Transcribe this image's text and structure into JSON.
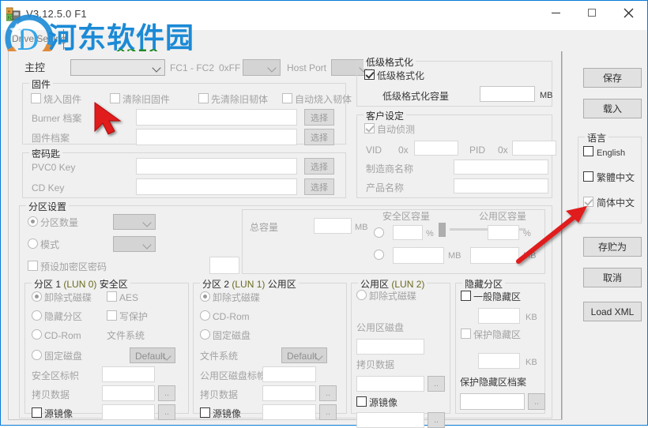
{
  "window": {
    "title": "V3.12.5.0 F1",
    "minimize_label": "minimize",
    "maximize_label": "maximize",
    "close_label": "close",
    "tab_label": "Drive Setting"
  },
  "watermark": {
    "text": "河东软件园",
    "url": "www.pc0359.cn"
  },
  "top_row": {
    "controller_label": "主控",
    "controller_value": "",
    "fc_label": "FC1 - FC2",
    "hex_label": "0xFF -",
    "hex_value": "",
    "host_port_label": "Host Port",
    "host_port_value": ""
  },
  "firmware": {
    "title": "固件",
    "burn_fw": "烧入固件",
    "clear_old_fw": "清除旧固件",
    "clear_first": "先清除旧韧体",
    "auto_burn": "自动烧入韧体",
    "burner_file_label": "Burner 档案",
    "burner_file_value": "",
    "fw_file_label": "固件档案",
    "fw_file_value": "",
    "choose_label": "选择"
  },
  "keys": {
    "title": "密码匙",
    "pvc0_label": "PVC0 Key",
    "pvc0_value": "",
    "cd_label": "CD Key",
    "cd_value": "",
    "choose_label": "选择"
  },
  "lowlevel": {
    "title": "低级格式化",
    "checkbox_label": "低级格式化",
    "capacity_label": "低级格式化容量",
    "capacity_value": "",
    "unit": "MB"
  },
  "customer": {
    "title": "客户设定",
    "auto_detect": "自动侦测",
    "vid_label": "VID",
    "vid_prefix": "0x",
    "vid_value": "",
    "pid_label": "PID",
    "pid_prefix": "0x",
    "pid_value": "",
    "vendor_label": "制造商名称",
    "vendor_value": "",
    "product_label": "产品名称",
    "product_value": ""
  },
  "partition_settings": {
    "title": "分区设置",
    "count_label": "分区数量",
    "count_value": "",
    "mode_label": "模式",
    "mode_value": "",
    "preset_pwd_label": "预设加密区密码",
    "preset_pwd_value": "",
    "total_label": "总容量",
    "total_value": "",
    "total_unit": "MB",
    "secure_cap_label": "安全区容量",
    "secure_pct_value": "",
    "secure_pct_unit": "%",
    "secure_mb_value": "",
    "secure_mb_unit": "MB",
    "public_cap_label": "公用区容量",
    "public_pct_value": "",
    "public_pct_unit": "%",
    "public_mb_value": "",
    "public_mb_unit": "MB"
  },
  "partition1": {
    "title": "分区 1 (LUN 0) 安全区",
    "title_pre": "分区 1",
    "title_lun": "(LUN 0)",
    "title_post": "安全区",
    "removable": "卸除式磁碟",
    "hidden": "隐藏分区",
    "cdrom": "CD-Rom",
    "fixed": "固定磁盘",
    "aes": "AES",
    "write_protect": "写保护",
    "filesystem_label": "文件系统",
    "filesystem_value": "Default",
    "volume_label": "安全区标帜",
    "volume_value": "",
    "copy_label": "拷贝数据",
    "copy_value": "",
    "source_image_label": "源镜像",
    "source_image_value": "",
    "browse_label": ".."
  },
  "partition2": {
    "title_pre": "分区 2",
    "title_lun": "(LUN 1)",
    "title_post": "公用区",
    "removable": "卸除式磁碟",
    "cdrom": "CD-Rom",
    "fixed": "固定磁盘",
    "filesystem_label": "文件系统",
    "filesystem_value": "Default",
    "volume_label": "公用区磁盘标帜",
    "volume_value": "",
    "copy_label": "拷贝数据",
    "copy_value": "",
    "source_image_label": "源镜像",
    "source_image_value": "",
    "browse_label": ".."
  },
  "public_lun2": {
    "title_pre": "公用区",
    "title_lun": "(LUN 2)",
    "removable": "卸除式磁碟",
    "disk_label": "公用区磁盘",
    "disk_value": "",
    "copy_label": "拷贝数据",
    "copy_value": "",
    "source_image_label": "源镜像",
    "source_image_value": "",
    "browse_label": ".."
  },
  "hidden_partition": {
    "title": "隐藏分区",
    "normal_label": "一般隐藏区",
    "normal_value": "",
    "normal_unit": "KB",
    "protect_label": "保护隐藏区",
    "protect_value": "",
    "protect_unit": "KB",
    "file_label": "保护隐藏区档案",
    "file_value": "",
    "browse_label": ".."
  },
  "sidebar": {
    "save": "保存",
    "load": "载入",
    "language_title": "语言",
    "lang_english": "English",
    "lang_traditional": "繁體中文",
    "lang_simplified": "简体中文",
    "save_as": "存贮为",
    "cancel": "取消",
    "load_xml": "Load XML"
  },
  "colors": {
    "window_border": "#0a7bd6",
    "panel_bg": "#f0f0f0",
    "arrow_red": "#e01b1b",
    "watermark_blue": "#1b8ad6",
    "watermark_green": "#1f8a1f"
  }
}
